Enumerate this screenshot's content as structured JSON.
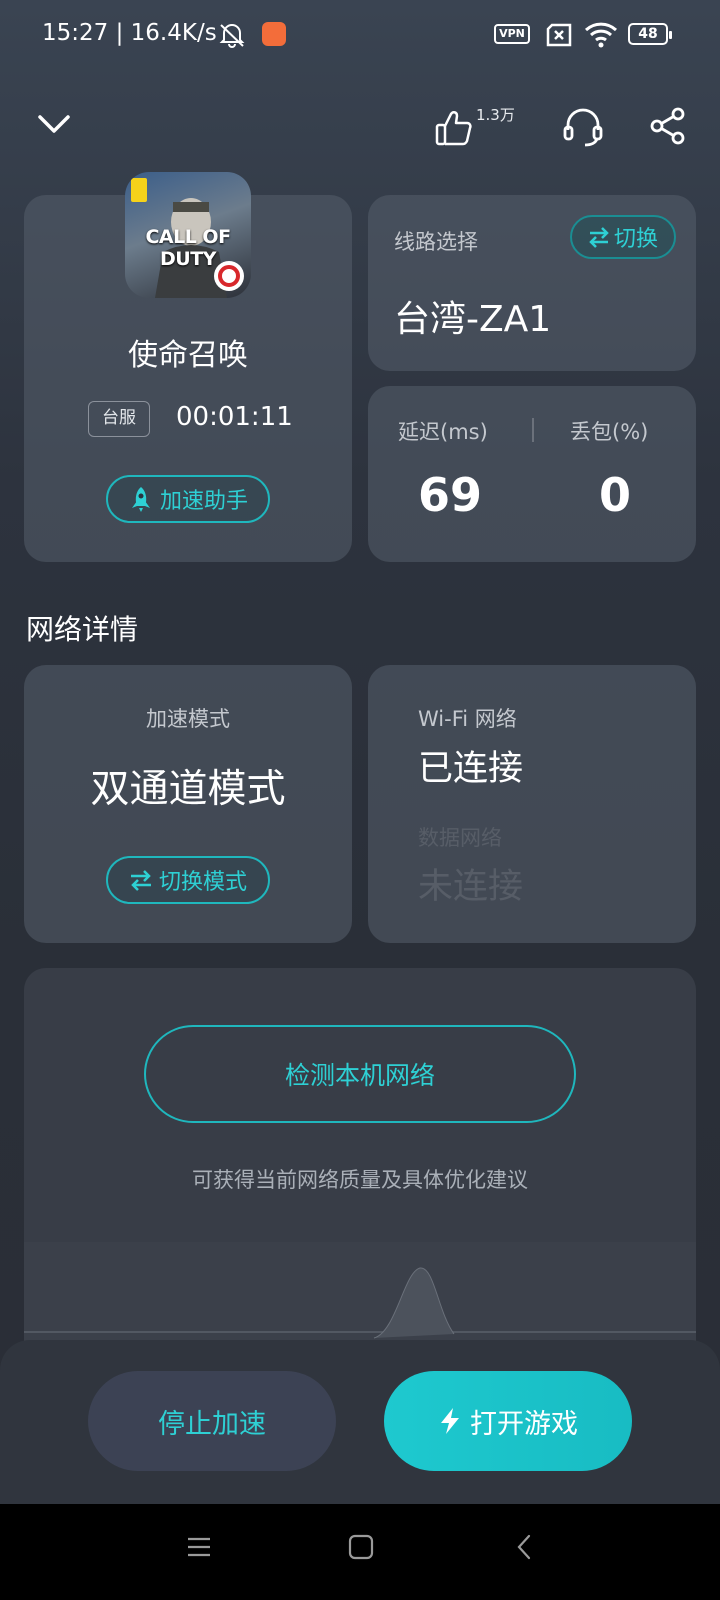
{
  "status_bar": {
    "time_speed": "15:27 | 16.4K/s",
    "vpn": "VPN",
    "battery": "48"
  },
  "header": {
    "like_count": "1.3万"
  },
  "game": {
    "name": "使命召唤",
    "icon_text": "CALL OF DUTY",
    "region": "台服",
    "elapsed": "00:01:11",
    "assistant_label": "加速助手"
  },
  "route": {
    "label": "线路选择",
    "switch_label": "切换",
    "value": "台湾-ZA1"
  },
  "stats": {
    "latency_label": "延迟(ms)",
    "latency_value": "69",
    "loss_label": "丢包(%)",
    "loss_value": "0"
  },
  "network": {
    "section_title": "网络详情",
    "mode_label": "加速模式",
    "mode_value": "双通道模式",
    "mode_switch_label": "切换模式",
    "wifi_label": "Wi-Fi 网络",
    "wifi_status": "已连接",
    "data_label": "数据网络",
    "data_status": "未连接"
  },
  "detect": {
    "button_label": "检测本机网络",
    "description": "可获得当前网络质量及具体优化建议"
  },
  "actions": {
    "stop_label": "停止加速",
    "open_label": "打开游戏"
  },
  "colors": {
    "accent": "#1fc4ca",
    "background": "#2d333e",
    "card": "#4a515c"
  }
}
